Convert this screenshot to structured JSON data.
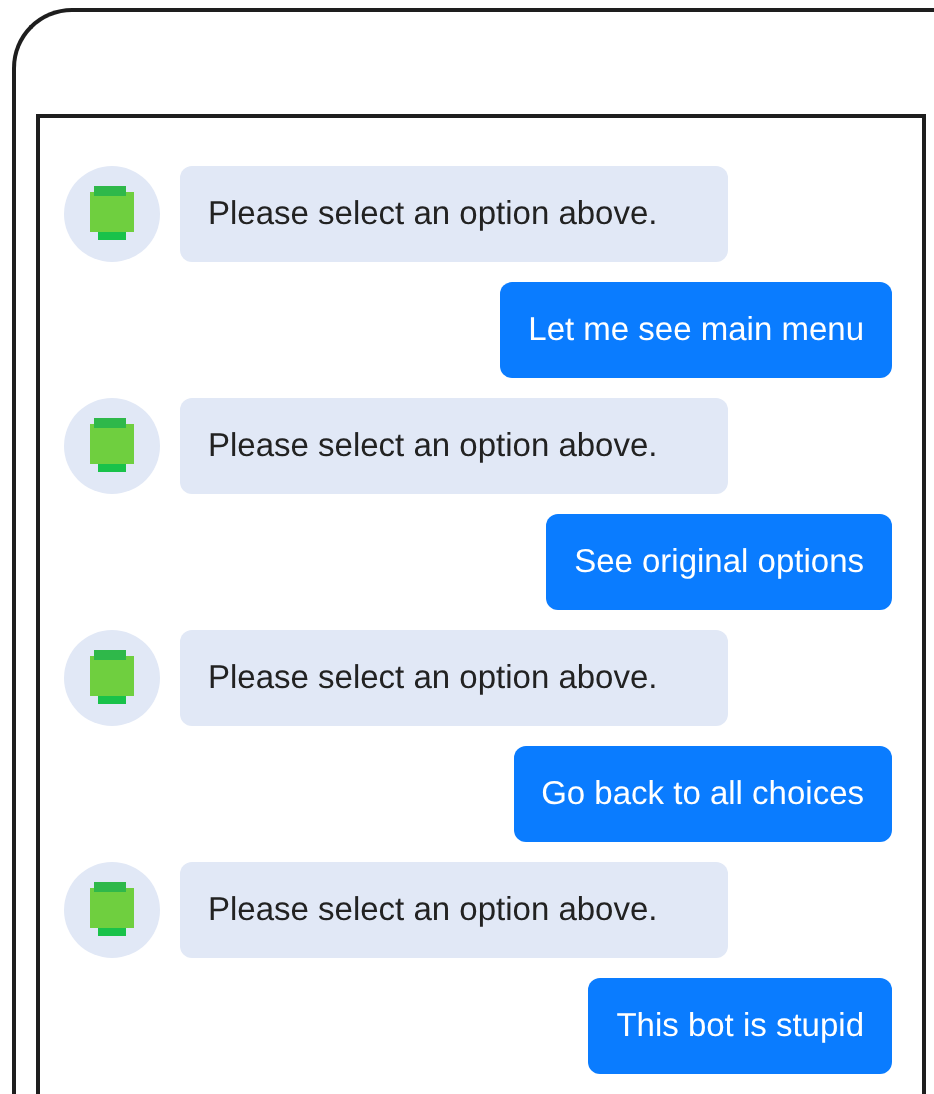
{
  "messages": [
    {
      "kind": "bot",
      "text": "Please select an option above."
    },
    {
      "kind": "user",
      "text": "Let me see main menu"
    },
    {
      "kind": "bot",
      "text": "Please select an option above."
    },
    {
      "kind": "user",
      "text": "See original options"
    },
    {
      "kind": "bot",
      "text": "Please select an option above."
    },
    {
      "kind": "user",
      "text": "Go back to all choices"
    },
    {
      "kind": "bot",
      "text": "Please select an option above."
    },
    {
      "kind": "user",
      "text": "This bot is stupid"
    }
  ]
}
